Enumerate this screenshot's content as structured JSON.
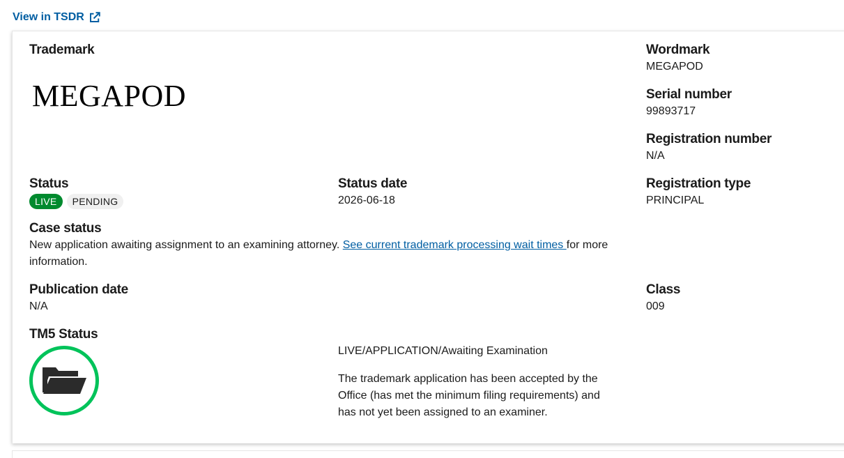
{
  "header": {
    "tsdr_link_label": "View in TSDR",
    "tsdr_icon": "external-link-icon"
  },
  "trademark": {
    "label": "Trademark",
    "image_text": "MEGAPOD"
  },
  "wordmark": {
    "label": "Wordmark",
    "value": "MEGAPOD"
  },
  "serial": {
    "label": "Serial number",
    "value": "99893717"
  },
  "registration_number": {
    "label": "Registration number",
    "value": "N/A"
  },
  "status": {
    "label": "Status",
    "badges": [
      "LIVE",
      "PENDING"
    ]
  },
  "status_date": {
    "label": "Status date",
    "value": "2026-06-18"
  },
  "registration_type": {
    "label": "Registration type",
    "value": "PRINCIPAL"
  },
  "case_status": {
    "label": "Case status",
    "text_before": "New application awaiting assignment to an examining attorney. ",
    "link_text": "See current trademark processing wait times ",
    "text_after": "for more information."
  },
  "publication_date": {
    "label": "Publication date",
    "value": "N/A"
  },
  "class": {
    "label": "Class",
    "value": "009"
  },
  "tm5": {
    "label": "TM5 Status",
    "icon": "open-folder-icon",
    "status_line": "LIVE/APPLICATION/Awaiting Examination",
    "description": "The trademark application has been accepted by the Office (has met the minimum filing requirements) and has not yet been assigned to an examiner."
  },
  "colors": {
    "link": "#005ea2",
    "live_badge": "#008a2e",
    "tm5_ring": "#00c35a"
  }
}
